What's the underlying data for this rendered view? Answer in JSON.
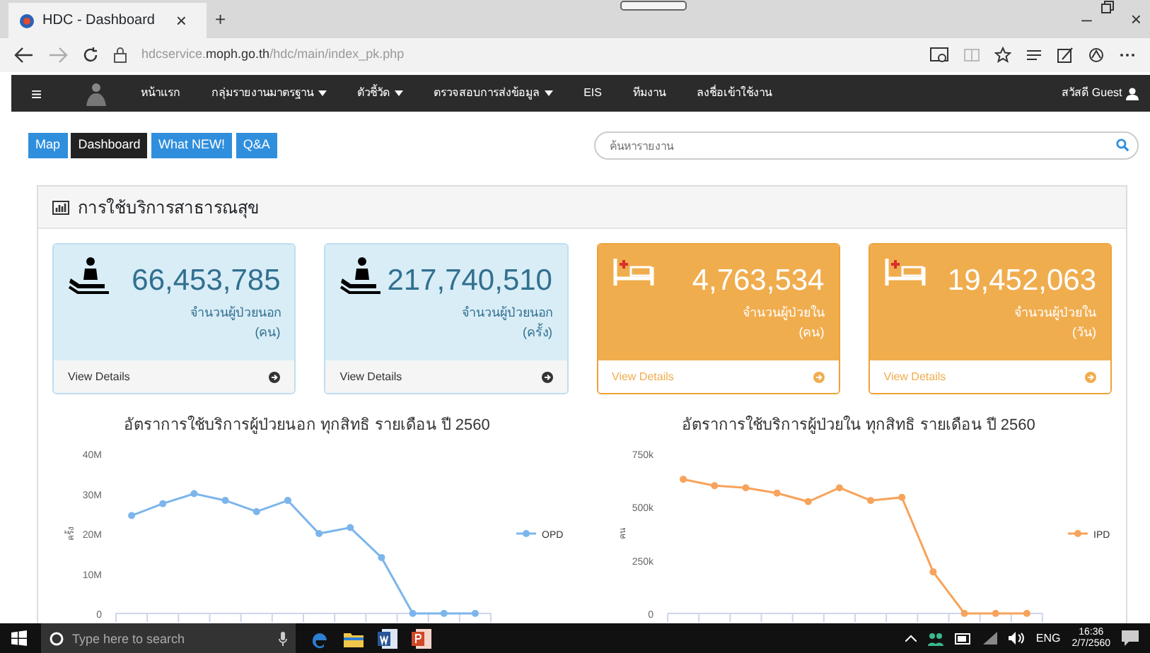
{
  "browser": {
    "tab_title": "HDC - Dashboard",
    "tab_close": "×",
    "new_tab": "+",
    "window_controls": [
      "–",
      "×"
    ],
    "address": "hdcservice.**moph.go.th**/hdc/main/index_pk.php"
  },
  "navbar": {
    "menu_glyph": "≡",
    "items": [
      {
        "label": "หน้าแรก",
        "dropdown": false
      },
      {
        "label": "กลุ่มรายงานมาตรฐาน",
        "dropdown": true
      },
      {
        "label": "ตัวชี้วัด",
        "dropdown": true
      },
      {
        "label": "ตรวจสอบการส่งข้อมูล",
        "dropdown": true
      },
      {
        "label": "EIS",
        "dropdown": false
      },
      {
        "label": "ทีมงาน",
        "dropdown": false
      },
      {
        "label": "ลงชื่อเข้าใช้งาน",
        "dropdown": false
      }
    ],
    "user": "สวัสดี Guest"
  },
  "nav_buttons": [
    {
      "label": "Map",
      "selected": false
    },
    {
      "label": "Dashboard",
      "selected": true
    },
    {
      "label": "What NEW!",
      "selected": false
    },
    {
      "label": "Q&A",
      "selected": false
    }
  ],
  "search": {
    "placeholder": "ค้นหารายงาน"
  },
  "panel": {
    "title": "การใช้บริการสาธารณสุข",
    "cards": [
      {
        "kind": "outpatient",
        "value": "66,453,785",
        "label": "จำนวนผู้ป่วยนอก",
        "unit": "(คน)",
        "footer": "View Details"
      },
      {
        "kind": "outpatient",
        "value": "217,740,510",
        "label": "จำนวนผู้ป่วยนอก",
        "unit": "(ครั้ง)",
        "footer": "View Details"
      },
      {
        "kind": "inpatient",
        "value": "4,763,534",
        "label": "จำนวนผู้ป่วยใน",
        "unit": "(คน)",
        "footer": "View Details"
      },
      {
        "kind": "inpatient",
        "value": "19,452,063",
        "label": "จำนวนผู้ป่วยใน",
        "unit": "(วัน)",
        "footer": "View Details"
      }
    ],
    "charts": [
      {
        "chart_data": {
          "type": "line",
          "title": "อัตราการใช้บริการผู้ป่วยนอก ทุกสิทธิ รายเดือน ปี 2560",
          "ylabel": "ครั้ง",
          "ylim": [
            0,
            40000000
          ],
          "yticks": [
            {
              "value": 0,
              "label": "0"
            },
            {
              "value": 10000000,
              "label": "10M"
            },
            {
              "value": 20000000,
              "label": "20M"
            },
            {
              "value": 30000000,
              "label": "30M"
            },
            {
              "value": 40000000,
              "label": "40M"
            }
          ],
          "series": [
            {
              "name": "OPD",
              "color": "#7cb5ec",
              "marker": "circle",
              "values": [
                24500000,
                27500000,
                30000000,
                28300000,
                25500000,
                28300000,
                20000000,
                21500000,
                14000000,
                0,
                0,
                0
              ]
            }
          ]
        }
      },
      {
        "chart_data": {
          "type": "line",
          "title": "อัตราการใช้บริการผู้ป่วยใน ทุกสิทธิ รายเดือน ปี 2560",
          "ylabel": "คน",
          "ylim": [
            0,
            750000
          ],
          "yticks": [
            {
              "value": 0,
              "label": "0"
            },
            {
              "value": 250000,
              "label": "250k"
            },
            {
              "value": 500000,
              "label": "500k"
            },
            {
              "value": 750000,
              "label": "750k"
            }
          ],
          "series": [
            {
              "name": "IPD",
              "color": "#f7a35c",
              "marker": "circle",
              "values": [
                630000,
                600000,
                590000,
                565000,
                525000,
                590000,
                530000,
                545000,
                195000,
                0,
                0,
                0
              ]
            }
          ]
        }
      }
    ]
  },
  "taskbar": {
    "search_placeholder": "Type here to search",
    "language": "ENG",
    "time": "16:36",
    "date": "2/7/2560"
  }
}
